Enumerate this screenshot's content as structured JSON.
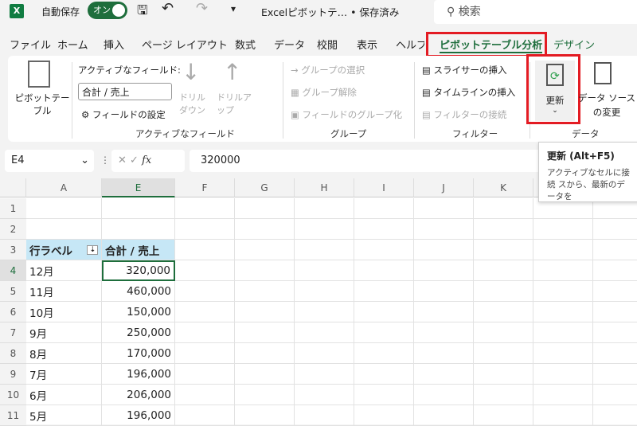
{
  "titlebar": {
    "autosave": "自動保存",
    "toggle": "オン",
    "filename": "Excelピボットテ… • 保存済み",
    "search": "検索"
  },
  "tabs": [
    "ファイル",
    "ホーム",
    "挿入",
    "ページ レイアウト",
    "数式",
    "データ",
    "校閲",
    "表示",
    "ヘルプ",
    "ピボットテーブル分析",
    "デザイン"
  ],
  "ribbon": {
    "pivot_table": "ピボットテーブル",
    "active_field_label": "アクティブなフィールド:",
    "active_field_value": "合計 / 売上",
    "field_settings": "フィールドの設定",
    "drill_down": "ドリル ダウン",
    "drill_up": "ドリルアップ",
    "group_active": "アクティブなフィールド",
    "group_selection": "グループの選択",
    "ungroup": "グループ解除",
    "group_field": "フィールドのグループ化",
    "group_group": "グループ",
    "insert_slicer": "スライサーの挿入",
    "insert_timeline": "タイムラインの挿入",
    "filter_connections": "フィルターの接続",
    "group_filter": "フィルター",
    "refresh": "更新",
    "change_source": "データ ソースの変更",
    "group_data": "データ"
  },
  "formula": {
    "namebox": "E4",
    "value": "320000"
  },
  "tooltip": {
    "title": "更新 (Alt+F5)",
    "body": "アクティブなセルに接続 スから、最新のデータを"
  },
  "columns": [
    "A",
    "E",
    "F",
    "G",
    "H",
    "I",
    "J",
    "K"
  ],
  "rows": [
    "1",
    "2",
    "3",
    "4",
    "5",
    "6",
    "7",
    "8",
    "9",
    "10",
    "11"
  ],
  "pivot": {
    "header_label": "行ラベル",
    "header_value": "合計 / 売上",
    "data": [
      [
        "12月",
        "320,000"
      ],
      [
        "11月",
        "460,000"
      ],
      [
        "10月",
        "150,000"
      ],
      [
        "9月",
        "250,000"
      ],
      [
        "8月",
        "170,000"
      ],
      [
        "7月",
        "196,000"
      ],
      [
        "6月",
        "206,000"
      ],
      [
        "5月",
        "196,000"
      ]
    ]
  },
  "colors": {
    "accent": "#1e6e3c",
    "highlight": "#e31b23",
    "pivot_header": "#c6e7f6"
  }
}
